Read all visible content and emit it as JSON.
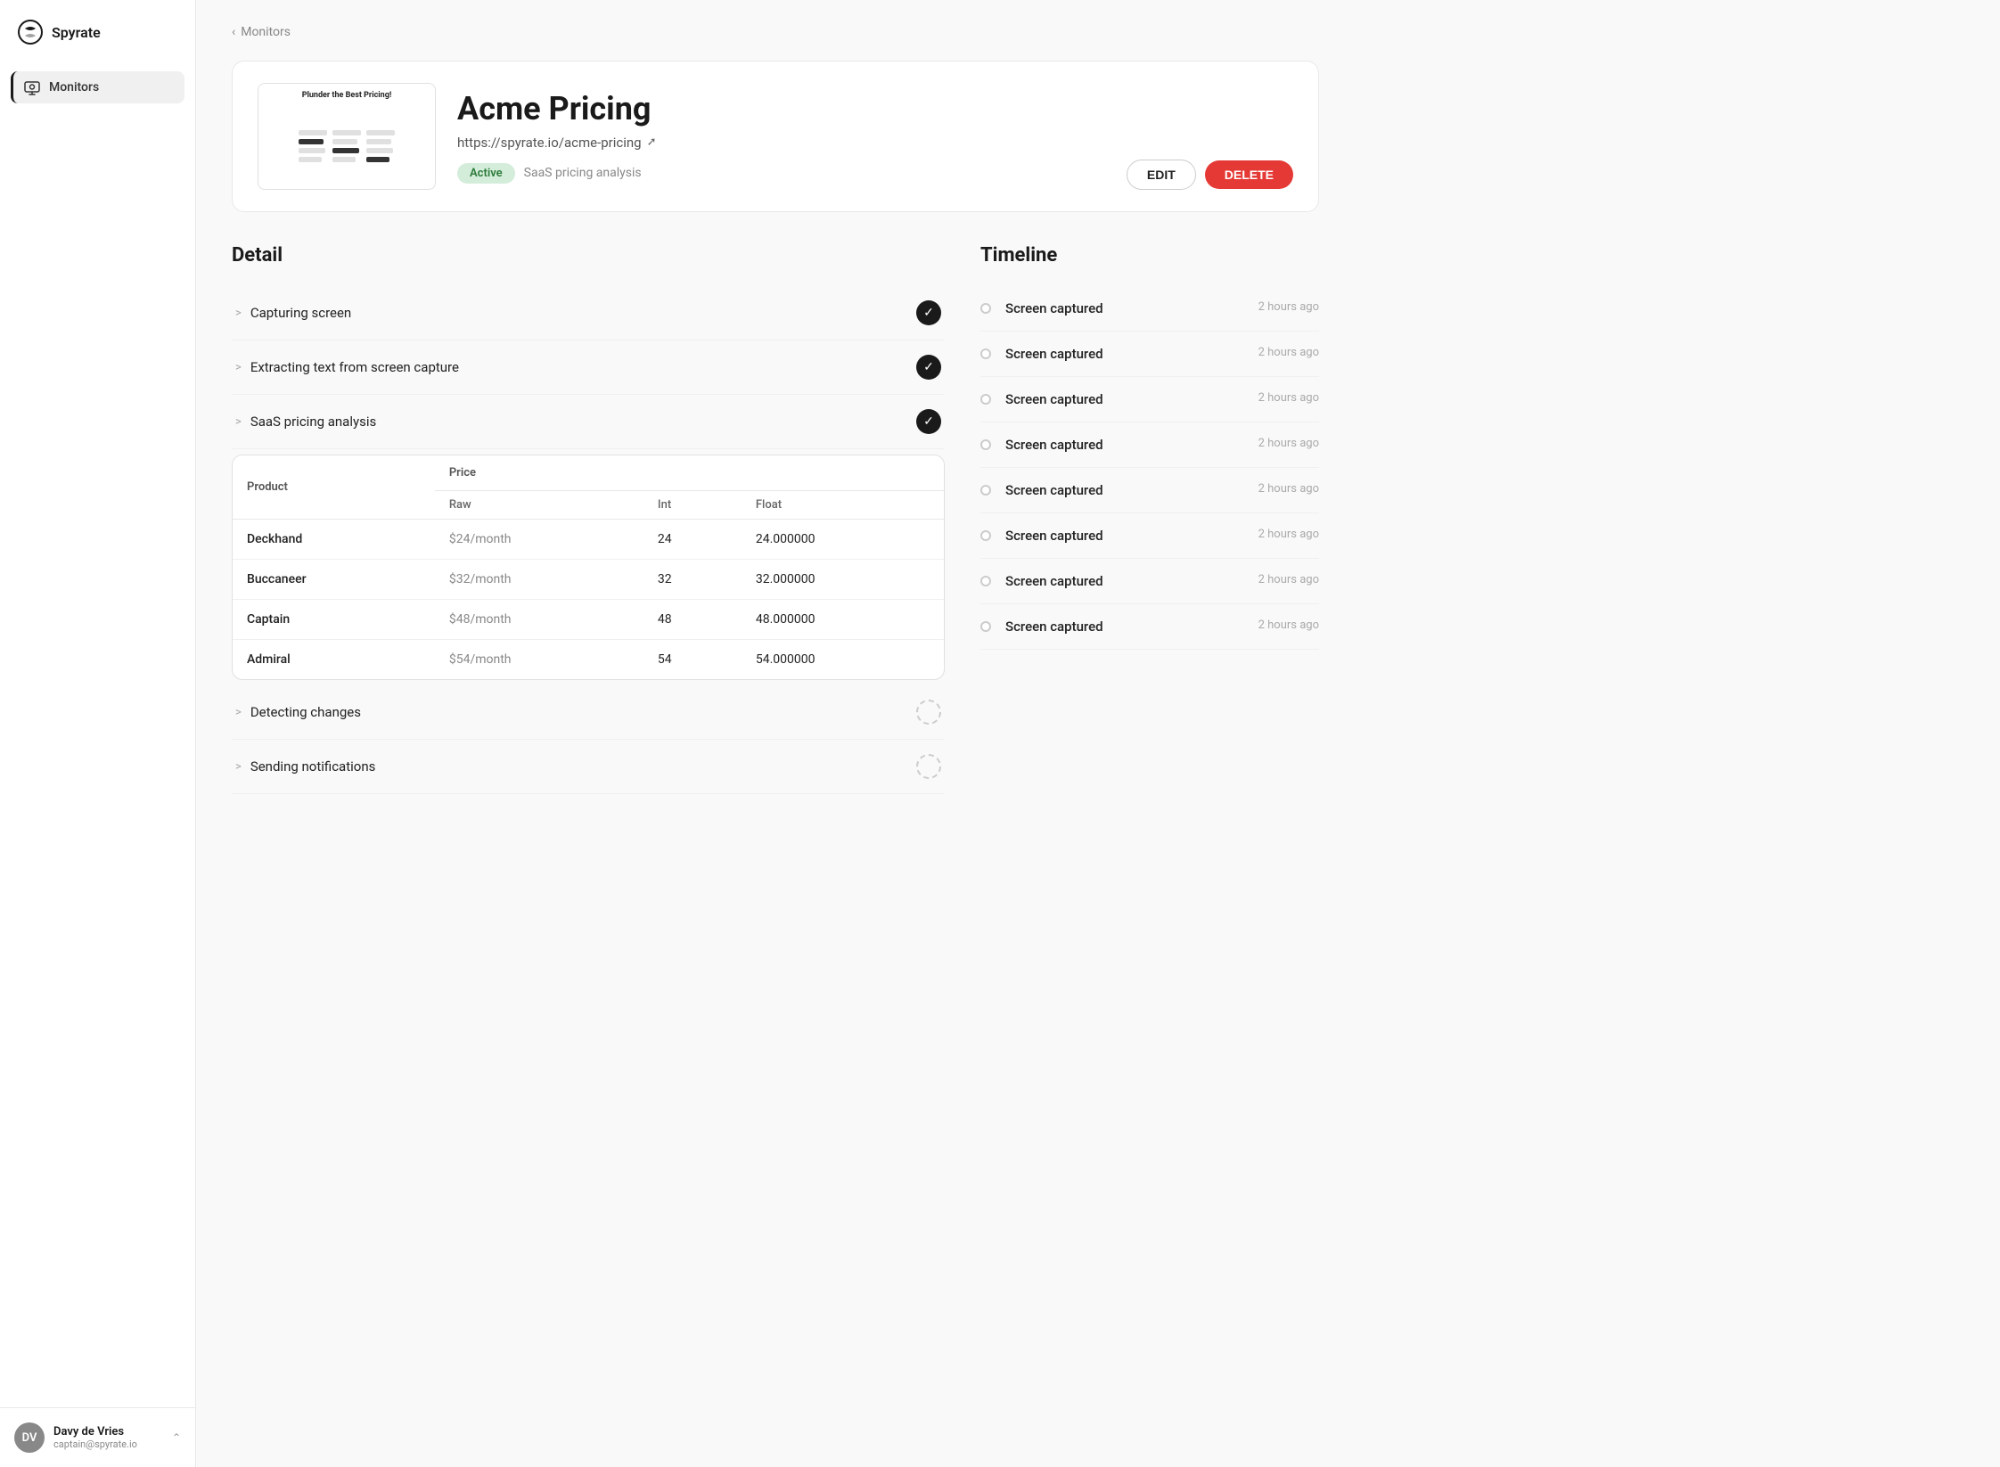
{
  "app": {
    "name": "Spyrate"
  },
  "sidebar": {
    "nav_items": [
      {
        "id": "monitors",
        "label": "Monitors",
        "active": true
      }
    ],
    "user": {
      "name": "Davy de Vries",
      "email": "captain@spyrate.io",
      "initials": "DV"
    }
  },
  "breadcrumb": {
    "label": "Monitors"
  },
  "monitor": {
    "title": "Acme Pricing",
    "url": "https://spyrate.io/acme-pricing",
    "status": "Active",
    "description": "SaaS pricing analysis",
    "edit_label": "EDIT",
    "delete_label": "DELETE"
  },
  "detail": {
    "section_title": "Detail",
    "items": [
      {
        "label": "Capturing screen",
        "status": "complete"
      },
      {
        "label": "Extracting text from screen capture",
        "status": "complete"
      },
      {
        "label": "SaaS pricing analysis",
        "status": "complete"
      },
      {
        "label": "Detecting changes",
        "status": "pending"
      },
      {
        "label": "Sending notifications",
        "status": "pending"
      }
    ],
    "table": {
      "product_header": "Product",
      "price_header": "Price",
      "sub_headers": [
        "Raw",
        "Int",
        "Float"
      ],
      "rows": [
        {
          "product": "Deckhand",
          "raw": "$24/month",
          "int": "24",
          "float": "24.000000"
        },
        {
          "product": "Buccaneer",
          "raw": "$32/month",
          "int": "32",
          "float": "32.000000"
        },
        {
          "product": "Captain",
          "raw": "$48/month",
          "int": "48",
          "float": "48.000000"
        },
        {
          "product": "Admiral",
          "raw": "$54/month",
          "int": "54",
          "float": "54.000000"
        }
      ]
    }
  },
  "timeline": {
    "section_title": "Timeline",
    "items": [
      {
        "label": "Screen captured",
        "time": "2 hours ago"
      },
      {
        "label": "Screen captured",
        "time": "2 hours ago"
      },
      {
        "label": "Screen captured",
        "time": "2 hours ago"
      },
      {
        "label": "Screen captured",
        "time": "2 hours ago"
      },
      {
        "label": "Screen captured",
        "time": "2 hours ago"
      },
      {
        "label": "Screen captured",
        "time": "2 hours ago"
      },
      {
        "label": "Screen captured",
        "time": "2 hours ago"
      },
      {
        "label": "Screen captured",
        "time": "2 hours ago"
      }
    ]
  }
}
